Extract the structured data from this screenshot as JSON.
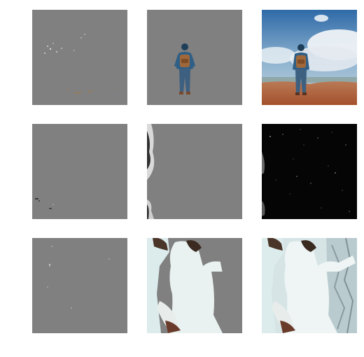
{
  "figure": {
    "columns": 3,
    "rows": 3,
    "background": "#ffffff",
    "cells": [
      {
        "row": 1,
        "col": 1,
        "content": "gray-noise-mask"
      },
      {
        "row": 1,
        "col": 2,
        "content": "hiker-cutout-on-gray"
      },
      {
        "row": 1,
        "col": 3,
        "content": "hiker-original-photo"
      },
      {
        "row": 2,
        "col": 1,
        "content": "gray-noise-mask"
      },
      {
        "row": 2,
        "col": 2,
        "content": "gray-with-left-edge-grayscale-cutout"
      },
      {
        "row": 2,
        "col": 3,
        "content": "dark-sparse-grayscale-map"
      },
      {
        "row": 3,
        "col": 1,
        "content": "gray-noise-mask"
      },
      {
        "row": 3,
        "col": 2,
        "content": "couple-cutout-on-gray"
      },
      {
        "row": 3,
        "col": 3,
        "content": "couple-original-photo"
      }
    ],
    "colors": {
      "mask_gray": "#808080",
      "dark_map": "#050505",
      "sky_top": "#3b76b8",
      "cloud": "#e8eef4",
      "ground": "#b8673e",
      "couple_tint": "#dfe9ea"
    }
  }
}
